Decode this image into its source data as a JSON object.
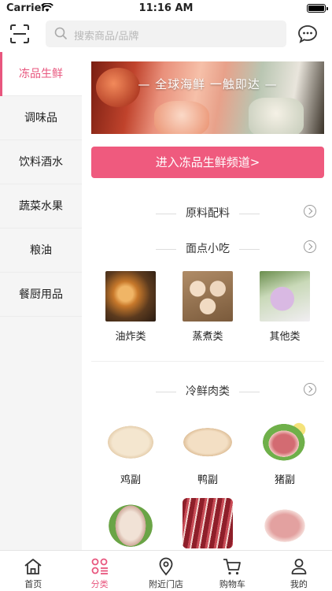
{
  "status_bar": {
    "carrier": "Carrier",
    "time": "11:16 AM"
  },
  "search": {
    "placeholder": "搜索商品/品牌"
  },
  "sidebar": {
    "items": [
      {
        "label": "冻品生鲜",
        "active": true
      },
      {
        "label": "调味品",
        "active": false
      },
      {
        "label": "饮料酒水",
        "active": false
      },
      {
        "label": "蔬菜水果",
        "active": false
      },
      {
        "label": "粮油",
        "active": false
      },
      {
        "label": "餐厨用品",
        "active": false
      }
    ]
  },
  "banner": {
    "slogan": "— 全球海鲜 一触即达 —"
  },
  "channel_button": {
    "label": "进入冻品生鲜频道>"
  },
  "sections": [
    {
      "title": "原料配料",
      "items": []
    },
    {
      "title": "面点小吃",
      "items": [
        {
          "label": "油炸类",
          "image": "fried-food-image"
        },
        {
          "label": "蒸煮类",
          "image": "dumplings-image"
        },
        {
          "label": "其他类",
          "image": "pastry-image"
        }
      ]
    },
    {
      "title": "冷鲜肉类",
      "items": [
        {
          "label": "鸡副",
          "image": "chicken-image"
        },
        {
          "label": "鸭副",
          "image": "duck-image"
        },
        {
          "label": "猪副",
          "image": "pork-image"
        },
        {
          "label": "",
          "image": "meat-image-1"
        },
        {
          "label": "",
          "image": "meat-image-2"
        },
        {
          "label": "",
          "image": "meat-image-3"
        }
      ]
    }
  ],
  "tabbar": {
    "items": [
      {
        "label": "首页",
        "icon": "home-icon",
        "active": false
      },
      {
        "label": "分类",
        "icon": "category-icon",
        "active": true
      },
      {
        "label": "附近门店",
        "icon": "location-icon",
        "active": false
      },
      {
        "label": "购物车",
        "icon": "cart-icon",
        "active": false
      },
      {
        "label": "我的",
        "icon": "profile-icon",
        "active": false
      }
    ]
  },
  "colors": {
    "accent": "#e8567e",
    "button": "#ef5a7e",
    "sidebar_bg": "#f5f5f5"
  }
}
